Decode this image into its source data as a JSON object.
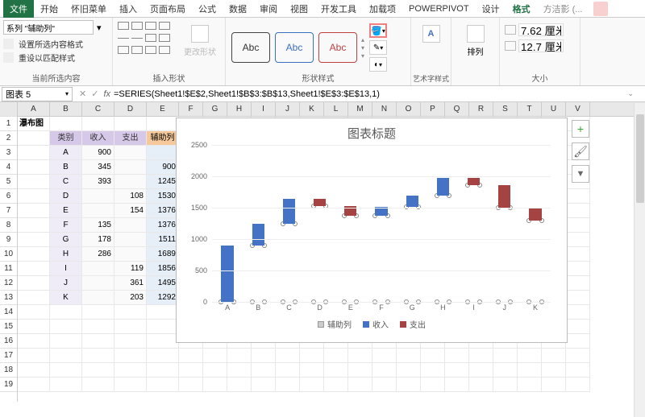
{
  "tabs": [
    "文件",
    "开始",
    "怀旧菜单",
    "插入",
    "页面布局",
    "公式",
    "数据",
    "审阅",
    "视图",
    "开发工具",
    "加载项",
    "POWERPIVOT",
    "设计",
    "格式"
  ],
  "active_tab": "格式",
  "user": "方洁影 (...",
  "ribbon": {
    "selection_value": "系列 \"辅助列\"",
    "set_selection": "设置所选内容格式",
    "reset_match": "重设以匹配样式",
    "group_selection": "当前所选内容",
    "change_shape": "更改形状",
    "group_insert": "插入形状",
    "abc": "Abc",
    "group_shapestyle": "形状样式",
    "wordart": "艺术字样式",
    "arrange": "排列",
    "size_h": "7.62 厘米",
    "size_w": "12.7 厘米",
    "group_size": "大小"
  },
  "namebox": "图表 5",
  "formula": "=SERIES(Sheet1!$E$2,Sheet1!$B$3:$B$13,Sheet1!$E$3:$E$13,1)",
  "columns": [
    "A",
    "B",
    "C",
    "D",
    "E",
    "F",
    "G",
    "H",
    "I",
    "J",
    "K",
    "L",
    "M",
    "N",
    "O",
    "P",
    "Q",
    "R",
    "S",
    "T",
    "U",
    "V"
  ],
  "row_count": 19,
  "table": {
    "title": "瀑布图",
    "headers": [
      "类别",
      "收入",
      "支出",
      "辅助列"
    ],
    "rows": [
      {
        "cat": "A",
        "in": 900,
        "out": "",
        "aux": ""
      },
      {
        "cat": "B",
        "in": 345,
        "out": "",
        "aux": 900
      },
      {
        "cat": "C",
        "in": 393,
        "out": "",
        "aux": 1245
      },
      {
        "cat": "D",
        "in": "",
        "out": 108,
        "aux": 1530
      },
      {
        "cat": "E",
        "in": "",
        "out": 154,
        "aux": 1376
      },
      {
        "cat": "F",
        "in": 135,
        "out": "",
        "aux": 1376
      },
      {
        "cat": "G",
        "in": 178,
        "out": "",
        "aux": 1511
      },
      {
        "cat": "H",
        "in": 286,
        "out": "",
        "aux": 1689
      },
      {
        "cat": "I",
        "in": "",
        "out": 119,
        "aux": 1856
      },
      {
        "cat": "J",
        "in": "",
        "out": 361,
        "aux": 1495
      },
      {
        "cat": "K",
        "in": "",
        "out": 203,
        "aux": 1292
      }
    ]
  },
  "chart_data": {
    "type": "bar",
    "title": "图表标题",
    "categories": [
      "A",
      "B",
      "C",
      "D",
      "E",
      "F",
      "G",
      "H",
      "I",
      "J",
      "K"
    ],
    "series": [
      {
        "name": "辅助列",
        "values": [
          0,
          900,
          1245,
          1530,
          1376,
          1376,
          1511,
          1689,
          1856,
          1495,
          1292
        ]
      },
      {
        "name": "收入",
        "values": [
          900,
          345,
          393,
          0,
          0,
          135,
          178,
          286,
          0,
          0,
          0
        ]
      },
      {
        "name": "支出",
        "values": [
          0,
          0,
          0,
          108,
          154,
          0,
          0,
          0,
          119,
          361,
          203
        ]
      }
    ],
    "ylabel": "",
    "xlabel": "",
    "ylim": [
      0,
      2500
    ],
    "yticks": [
      0,
      500,
      1000,
      1500,
      2000,
      2500
    ],
    "legend": [
      "辅助列",
      "收入",
      "支出"
    ]
  }
}
